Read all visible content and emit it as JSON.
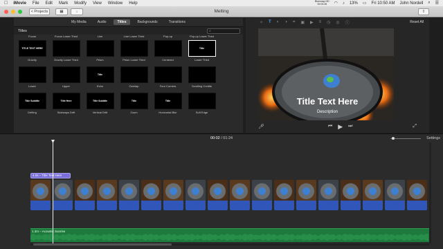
{
  "menubar": {
    "apple": "",
    "items": [
      "iMovie",
      "File",
      "Edit",
      "Mark",
      "Modify",
      "View",
      "Window",
      "Help"
    ],
    "status_mini": [
      "Bluesnap HD",
      "00:03:28"
    ],
    "battery": "13%",
    "clock": "Fri 10:50 AM",
    "user": "John Nordell"
  },
  "titlebar": {
    "projects_label": "< Projects",
    "window_title": "Melting"
  },
  "browser": {
    "tabs": [
      {
        "label": "My Media",
        "active": false
      },
      {
        "label": "Audio",
        "active": false
      },
      {
        "label": "Titles",
        "active": true
      },
      {
        "label": "Backgrounds",
        "active": false
      },
      {
        "label": "Transitions",
        "active": false
      }
    ],
    "section_title": "Titles",
    "top_row_names": [
      "Focus",
      "Focus Lower Third",
      "Line",
      "Line Lower Third",
      "Pop-up",
      "Pop-up Lower Third"
    ],
    "tiles": [
      {
        "name": "Gravity",
        "thumb": "TITLE TEXT HERE",
        "selected": false
      },
      {
        "name": "Gravity Lower Third",
        "thumb": "",
        "selected": false
      },
      {
        "name": "Prism",
        "thumb": "",
        "selected": false
      },
      {
        "name": "Prism Lower Third",
        "thumb": "",
        "selected": false
      },
      {
        "name": "Centered",
        "thumb": "",
        "selected": false
      },
      {
        "name": "Lower Third",
        "thumb": "Title",
        "selected": true
      },
      {
        "name": "Lower",
        "thumb": "",
        "selected": false
      },
      {
        "name": "Upper",
        "thumb": "",
        "selected": false
      },
      {
        "name": "Echo",
        "thumb": "Title",
        "selected": false
      },
      {
        "name": "Overlap",
        "thumb": "",
        "selected": false
      },
      {
        "name": "Four Corners",
        "thumb": "",
        "selected": false
      },
      {
        "name": "Scrolling Credits",
        "thumb": "",
        "selected": false
      },
      {
        "name": "Drifting",
        "thumb": "Title Subtitle",
        "selected": false
      },
      {
        "name": "Sideways Drift",
        "thumb": "Title Here",
        "selected": false
      },
      {
        "name": "Vertical Drift",
        "thumb": "Title Subtitle",
        "selected": false
      },
      {
        "name": "Zoom",
        "thumb": "Title",
        "selected": false
      },
      {
        "name": "Horizontal Blur",
        "thumb": "Title",
        "selected": false
      },
      {
        "name": "Soft Edge",
        "thumb": "",
        "selected": false
      }
    ]
  },
  "viewer": {
    "reset_all": "Reset All",
    "overlay_title": "Title Text Here",
    "overlay_subtitle": "Description"
  },
  "timeline": {
    "current_time": "00:02",
    "separator": " / ",
    "total_time": "01:24",
    "settings_label": "Settings",
    "zoom_level": 0.05,
    "title_clip_label": "4.0s – Title Text Here",
    "audio_clip_label": "1.3m – Acoustic Sunrise",
    "clip_count": 18
  },
  "colors": {
    "title_clip": "#7b70d9",
    "audio_track": "#1d7a3c",
    "audio_wave": "#2ea356",
    "video_audio": "#2f56b8",
    "accent_close": "#fc5f57",
    "accent_min": "#fdbc2e",
    "accent_max": "#2ac940"
  },
  "icons": [
    "apple-icon",
    "projects-icon",
    "layout-icon",
    "import-icon",
    "share-icon",
    "magic-wand-icon",
    "color-balance-icon",
    "crop-icon",
    "stabilize-icon",
    "volume-icon",
    "noise-icon",
    "speed-icon",
    "filter-icon",
    "info-icon",
    "microphone-icon",
    "skip-back-icon",
    "play-icon",
    "skip-forward-icon",
    "fullscreen-icon",
    "search-icon"
  ]
}
